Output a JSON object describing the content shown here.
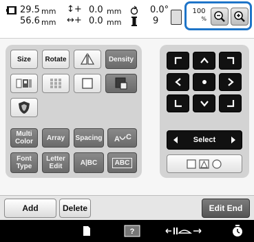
{
  "status": {
    "width_value": "29.5",
    "width_unit": "mm",
    "height_value": "56.6",
    "height_unit": "mm",
    "offset_v_value": "0.0",
    "offset_v_unit": "mm",
    "offset_h_value": "0.0",
    "offset_h_unit": "mm",
    "angle_value": "0.0°",
    "thread_count": "9",
    "zoom_percent_value": "100",
    "zoom_percent_symbol": "%"
  },
  "edit_panel": {
    "size_label": "Size",
    "rotate_label": "Rotate",
    "density_label": "Density",
    "multi_color_label_1": "Multi",
    "multi_color_label_2": "Color",
    "array_label": "Array",
    "spacing_label": "Spacing",
    "font_type_label_1": "Font",
    "font_type_label_2": "Type",
    "letter_edit_label_1": "Letter",
    "letter_edit_label_2": "Edit",
    "ab_label": "A|BC",
    "abc_label": "ABC"
  },
  "move_panel": {
    "select_label": "Select"
  },
  "footer": {
    "add_label": "Add",
    "delete_label": "Delete",
    "edit_end_label": "Edit End"
  },
  "colors": {
    "highlight": "#1e74c8",
    "panel": "#d3d3d3",
    "dark_button": "#7a7a7a",
    "taskbar": "#000000"
  }
}
